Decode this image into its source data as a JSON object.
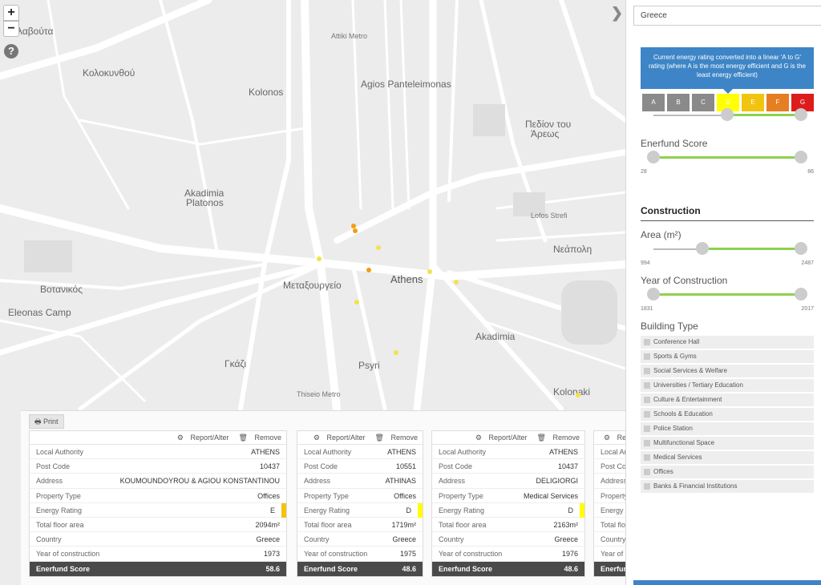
{
  "map": {
    "zoom_in_label": "+",
    "zoom_out_label": "−",
    "help_label": "?",
    "labels": [
      {
        "text": "Κολοκυνθού",
        "cls": "big"
      },
      {
        "text": "Kolonos",
        "cls": "big"
      },
      {
        "text": "Agios Panteleimonas",
        "cls": "big"
      },
      {
        "text": "Πεδίον του",
        "cls": "big"
      },
      {
        "text": "Άρεως",
        "cls": "big"
      },
      {
        "text": "Akadimia",
        "cls": "big"
      },
      {
        "text": "Platonos",
        "cls": "big"
      },
      {
        "text": "Μεταξουργείο",
        "cls": "big"
      },
      {
        "text": "Athens",
        "cls": "huge"
      },
      {
        "text": "Νεάπολη",
        "cls": "big"
      },
      {
        "text": "Βοτανικός",
        "cls": "big"
      },
      {
        "text": "Eleonas Camp",
        "cls": "big"
      },
      {
        "text": "Akadimia",
        "cls": "big"
      },
      {
        "text": "Γκάζι",
        "cls": "big"
      },
      {
        "text": "Psyri",
        "cls": "big"
      },
      {
        "text": "Kolonaki",
        "cls": "big"
      },
      {
        "text": "λαβούτα",
        "cls": "big"
      },
      {
        "text": "Lofos Strefi",
        "cls": ""
      },
      {
        "text": "Thiseio Metro",
        "cls": ""
      },
      {
        "text": "Attiki Metro",
        "cls": ""
      }
    ],
    "markers": [
      {
        "color": "#f39c12"
      },
      {
        "color": "#f39c12"
      },
      {
        "color": "#f1e34a"
      },
      {
        "color": "#f1e34a"
      },
      {
        "color": "#f39c12"
      },
      {
        "color": "#f1e34a"
      },
      {
        "color": "#f1e34a"
      },
      {
        "color": "#f1e34a"
      },
      {
        "color": "#f1e34a"
      },
      {
        "color": "#f1e34a"
      }
    ]
  },
  "bottom_panel": {
    "print_label": "Print",
    "report_label": "Report/Alter",
    "remove_label": "Remove",
    "cards": [
      {
        "rows": [
          {
            "label": "Local Authority",
            "value": "ATHENS"
          },
          {
            "label": "Post Code",
            "value": "10437"
          },
          {
            "label": "Address",
            "value": "KOUMOUNDOYROU & AGIOU KONSTANTINOU"
          },
          {
            "label": "Property Type",
            "value": "Offices"
          },
          {
            "label": "Energy Rating",
            "value": "E",
            "rating_color": "#f1c40f"
          },
          {
            "label": "Total floor area",
            "value": "2094m²"
          },
          {
            "label": "Country",
            "value": "Greece"
          },
          {
            "label": "Year of construction",
            "value": "1973"
          },
          {
            "label": "Enerfund Score",
            "value": "58.6"
          }
        ]
      },
      {
        "rows": [
          {
            "label": "Local Authority",
            "value": "ATHENS"
          },
          {
            "label": "Post Code",
            "value": "10551"
          },
          {
            "label": "Address",
            "value": "ATHINAS"
          },
          {
            "label": "Property Type",
            "value": "Offices"
          },
          {
            "label": "Energy Rating",
            "value": "D",
            "rating_color": "#ffff00"
          },
          {
            "label": "Total floor area",
            "value": "1719m²"
          },
          {
            "label": "Country",
            "value": "Greece"
          },
          {
            "label": "Year of construction",
            "value": "1975"
          },
          {
            "label": "Enerfund Score",
            "value": "48.6"
          }
        ]
      },
      {
        "rows": [
          {
            "label": "Local Authority",
            "value": "ATHENS"
          },
          {
            "label": "Post Code",
            "value": "10437"
          },
          {
            "label": "Address",
            "value": "DELIGIORGI"
          },
          {
            "label": "Property Type",
            "value": "Medical Services"
          },
          {
            "label": "Energy Rating",
            "value": "D",
            "rating_color": "#ffff00"
          },
          {
            "label": "Total floor area",
            "value": "2163m²"
          },
          {
            "label": "Country",
            "value": "Greece"
          },
          {
            "label": "Year of construction",
            "value": "1976"
          },
          {
            "label": "Enerfund Score",
            "value": "48.6"
          }
        ]
      },
      {
        "rows": [
          {
            "label": "Local Authority",
            "value": ""
          },
          {
            "label": "Post Code",
            "value": ""
          },
          {
            "label": "Address",
            "value": ""
          },
          {
            "label": "Property Type",
            "value": ""
          },
          {
            "label": "Energy Rating",
            "value": ""
          },
          {
            "label": "Total floor area",
            "value": ""
          },
          {
            "label": "Country",
            "value": ""
          },
          {
            "label": "Year of construction",
            "value": ""
          },
          {
            "label": "Enerfund Score",
            "value": ""
          }
        ]
      }
    ]
  },
  "sidebar": {
    "country_value": "Greece",
    "info_text": "Current energy rating converted into a linear 'A to G' rating (where A is the most energy efficient and G is the least energy efficient)",
    "ratings": [
      {
        "label": "A",
        "color": "#8a8a8a"
      },
      {
        "label": "B",
        "color": "#8a8a8a"
      },
      {
        "label": "C",
        "color": "#8a8a8a"
      },
      {
        "label": "D",
        "color": "#ffff00"
      },
      {
        "label": "E",
        "color": "#f1c40f"
      },
      {
        "label": "F",
        "color": "#e67e22"
      },
      {
        "label": "G",
        "color": "#dd1c1c"
      }
    ],
    "rating_range": {
      "from": "D",
      "to": "G"
    },
    "enerfund": {
      "title": "Enerfund Score",
      "min": "28",
      "max": "86",
      "low": 28,
      "high": 86
    },
    "construction_title": "Construction",
    "area": {
      "title": "Area (m²)",
      "min": "994",
      "max": "2487",
      "low": 994,
      "high": 2487,
      "range_min": 0,
      "range_max": 2487
    },
    "year": {
      "title": "Year of Construction",
      "min": "1831",
      "max": "2017",
      "low": 1831,
      "high": 2017
    },
    "building_type_title": "Building Type",
    "building_types": [
      "Conference Hall",
      "Sports & Gyms",
      "Social Services & Welfare",
      "Universities / Tertiary Education",
      "Culture & Entertainment",
      "Schools & Education",
      "Police Station",
      "Multifunctional Space",
      "Medical Services",
      "Offices",
      "Banks & Financial Institutions"
    ]
  }
}
